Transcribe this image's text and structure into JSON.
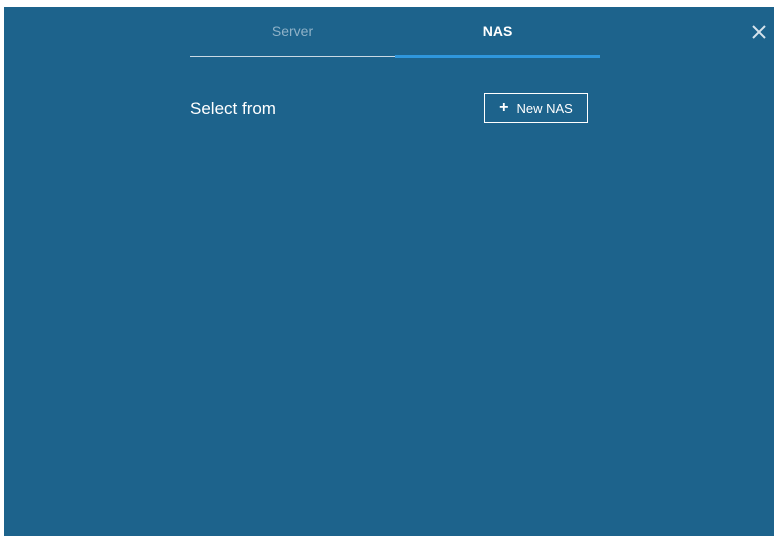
{
  "tabs": [
    {
      "label": "Server",
      "active": false
    },
    {
      "label": "NAS",
      "active": true
    }
  ],
  "close_icon": "close-icon",
  "select_label": "Select from",
  "new_button": {
    "icon": "+",
    "label": "New NAS"
  },
  "colors": {
    "panel_background": "#1d638c",
    "active_tab_underline": "#2f97dd",
    "inactive_tab_text": "#8fb2c8",
    "text": "#ffffff"
  }
}
